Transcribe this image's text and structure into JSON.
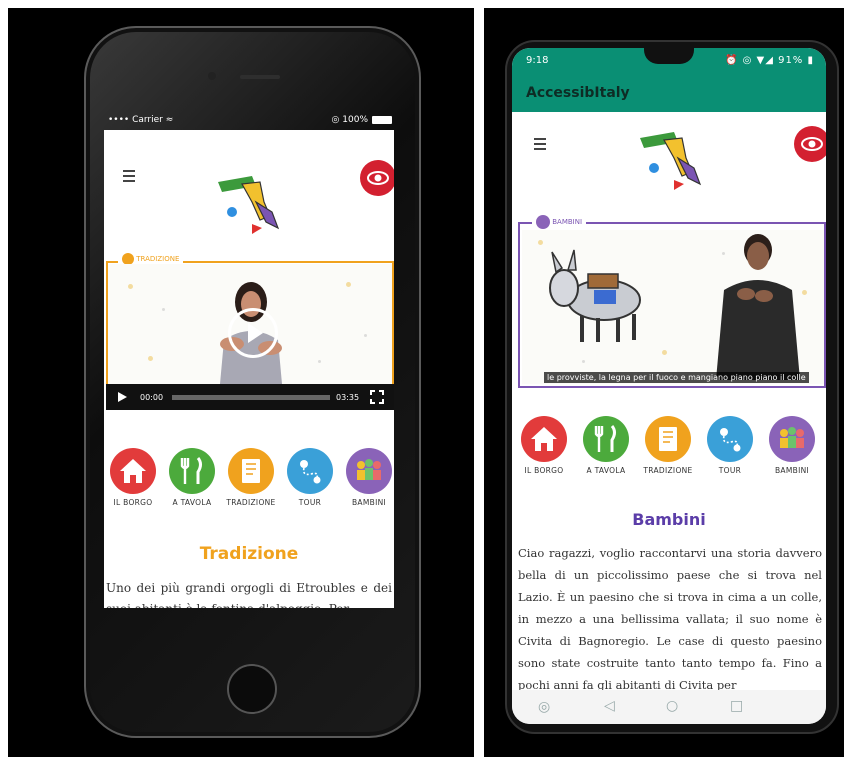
{
  "left_phone": {
    "status": {
      "carrier": "•••• Carrier ≈",
      "battery": "◎ 100%"
    },
    "video": {
      "category_tag": "TRADIZIONE",
      "current_time": "00:00",
      "duration": "03:35",
      "progress": 0
    },
    "categories": [
      {
        "label": "IL BORGO",
        "color": "#e23b3b",
        "icon": "house-icon"
      },
      {
        "label": "A TAVOLA",
        "color": "#4caa3c",
        "icon": "fork-knife-icon"
      },
      {
        "label": "TRADIZIONE",
        "color": "#f0a21e",
        "icon": "book-icon"
      },
      {
        "label": "TOUR",
        "color": "#3aa0d8",
        "icon": "map-route-icon"
      },
      {
        "label": "BAMBINI",
        "color": "#8a63b8",
        "icon": "children-icon"
      }
    ],
    "section_title": "Tradizione",
    "section_title_color": "#f0a21e",
    "body_text": "Uno dei più grandi orgogli di Etroubles e dei suoi abitanti è la fontina d'alpeggio. Per"
  },
  "right_phone": {
    "status": {
      "time": "9:18",
      "icons": "⏰ ◎ ▼◢ 91% ▮"
    },
    "app_title": "AccessibItaly",
    "theme_color": "#0a8f74",
    "video": {
      "category_tag": "BAMBINI",
      "subtitle": "le provviste, la legna per il fuoco e mangiano piano piano il colle"
    },
    "categories": [
      {
        "label": "IL BORGO",
        "color": "#e23b3b",
        "icon": "house-icon"
      },
      {
        "label": "A TAVOLA",
        "color": "#4caa3c",
        "icon": "fork-knife-icon"
      },
      {
        "label": "TRADIZIONE",
        "color": "#f0a21e",
        "icon": "book-icon"
      },
      {
        "label": "TOUR",
        "color": "#3aa0d8",
        "icon": "map-route-icon"
      },
      {
        "label": "BAMBINI",
        "color": "#8a63b8",
        "icon": "children-icon"
      }
    ],
    "section_title": "Bambini",
    "section_title_color": "#5b3da8",
    "body_text": "Ciao ragazzi, voglio raccontarvi una storia davvero bella di un piccolissimo paese che si trova nel Lazio. È un paesino che si trova in cima a un colle, in mezzo a una bellissima vallata; il suo nome è Civita di Bagnoregio. Le case di questo paesino sono state costruite tanto tanto tempo fa. Fino a pochi anni fa gli abitanti di Civita per"
  }
}
